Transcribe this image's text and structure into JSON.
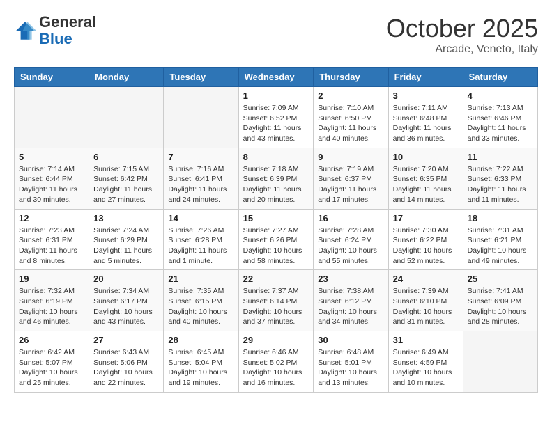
{
  "header": {
    "logo_line1": "General",
    "logo_line2": "Blue",
    "month": "October 2025",
    "location": "Arcade, Veneto, Italy"
  },
  "weekdays": [
    "Sunday",
    "Monday",
    "Tuesday",
    "Wednesday",
    "Thursday",
    "Friday",
    "Saturday"
  ],
  "weeks": [
    [
      {
        "day": "",
        "info": ""
      },
      {
        "day": "",
        "info": ""
      },
      {
        "day": "",
        "info": ""
      },
      {
        "day": "1",
        "info": "Sunrise: 7:09 AM\nSunset: 6:52 PM\nDaylight: 11 hours and 43 minutes."
      },
      {
        "day": "2",
        "info": "Sunrise: 7:10 AM\nSunset: 6:50 PM\nDaylight: 11 hours and 40 minutes."
      },
      {
        "day": "3",
        "info": "Sunrise: 7:11 AM\nSunset: 6:48 PM\nDaylight: 11 hours and 36 minutes."
      },
      {
        "day": "4",
        "info": "Sunrise: 7:13 AM\nSunset: 6:46 PM\nDaylight: 11 hours and 33 minutes."
      }
    ],
    [
      {
        "day": "5",
        "info": "Sunrise: 7:14 AM\nSunset: 6:44 PM\nDaylight: 11 hours and 30 minutes."
      },
      {
        "day": "6",
        "info": "Sunrise: 7:15 AM\nSunset: 6:42 PM\nDaylight: 11 hours and 27 minutes."
      },
      {
        "day": "7",
        "info": "Sunrise: 7:16 AM\nSunset: 6:41 PM\nDaylight: 11 hours and 24 minutes."
      },
      {
        "day": "8",
        "info": "Sunrise: 7:18 AM\nSunset: 6:39 PM\nDaylight: 11 hours and 20 minutes."
      },
      {
        "day": "9",
        "info": "Sunrise: 7:19 AM\nSunset: 6:37 PM\nDaylight: 11 hours and 17 minutes."
      },
      {
        "day": "10",
        "info": "Sunrise: 7:20 AM\nSunset: 6:35 PM\nDaylight: 11 hours and 14 minutes."
      },
      {
        "day": "11",
        "info": "Sunrise: 7:22 AM\nSunset: 6:33 PM\nDaylight: 11 hours and 11 minutes."
      }
    ],
    [
      {
        "day": "12",
        "info": "Sunrise: 7:23 AM\nSunset: 6:31 PM\nDaylight: 11 hours and 8 minutes."
      },
      {
        "day": "13",
        "info": "Sunrise: 7:24 AM\nSunset: 6:29 PM\nDaylight: 11 hours and 5 minutes."
      },
      {
        "day": "14",
        "info": "Sunrise: 7:26 AM\nSunset: 6:28 PM\nDaylight: 11 hours and 1 minute."
      },
      {
        "day": "15",
        "info": "Sunrise: 7:27 AM\nSunset: 6:26 PM\nDaylight: 10 hours and 58 minutes."
      },
      {
        "day": "16",
        "info": "Sunrise: 7:28 AM\nSunset: 6:24 PM\nDaylight: 10 hours and 55 minutes."
      },
      {
        "day": "17",
        "info": "Sunrise: 7:30 AM\nSunset: 6:22 PM\nDaylight: 10 hours and 52 minutes."
      },
      {
        "day": "18",
        "info": "Sunrise: 7:31 AM\nSunset: 6:21 PM\nDaylight: 10 hours and 49 minutes."
      }
    ],
    [
      {
        "day": "19",
        "info": "Sunrise: 7:32 AM\nSunset: 6:19 PM\nDaylight: 10 hours and 46 minutes."
      },
      {
        "day": "20",
        "info": "Sunrise: 7:34 AM\nSunset: 6:17 PM\nDaylight: 10 hours and 43 minutes."
      },
      {
        "day": "21",
        "info": "Sunrise: 7:35 AM\nSunset: 6:15 PM\nDaylight: 10 hours and 40 minutes."
      },
      {
        "day": "22",
        "info": "Sunrise: 7:37 AM\nSunset: 6:14 PM\nDaylight: 10 hours and 37 minutes."
      },
      {
        "day": "23",
        "info": "Sunrise: 7:38 AM\nSunset: 6:12 PM\nDaylight: 10 hours and 34 minutes."
      },
      {
        "day": "24",
        "info": "Sunrise: 7:39 AM\nSunset: 6:10 PM\nDaylight: 10 hours and 31 minutes."
      },
      {
        "day": "25",
        "info": "Sunrise: 7:41 AM\nSunset: 6:09 PM\nDaylight: 10 hours and 28 minutes."
      }
    ],
    [
      {
        "day": "26",
        "info": "Sunrise: 6:42 AM\nSunset: 5:07 PM\nDaylight: 10 hours and 25 minutes."
      },
      {
        "day": "27",
        "info": "Sunrise: 6:43 AM\nSunset: 5:06 PM\nDaylight: 10 hours and 22 minutes."
      },
      {
        "day": "28",
        "info": "Sunrise: 6:45 AM\nSunset: 5:04 PM\nDaylight: 10 hours and 19 minutes."
      },
      {
        "day": "29",
        "info": "Sunrise: 6:46 AM\nSunset: 5:02 PM\nDaylight: 10 hours and 16 minutes."
      },
      {
        "day": "30",
        "info": "Sunrise: 6:48 AM\nSunset: 5:01 PM\nDaylight: 10 hours and 13 minutes."
      },
      {
        "day": "31",
        "info": "Sunrise: 6:49 AM\nSunset: 4:59 PM\nDaylight: 10 hours and 10 minutes."
      },
      {
        "day": "",
        "info": ""
      }
    ]
  ]
}
